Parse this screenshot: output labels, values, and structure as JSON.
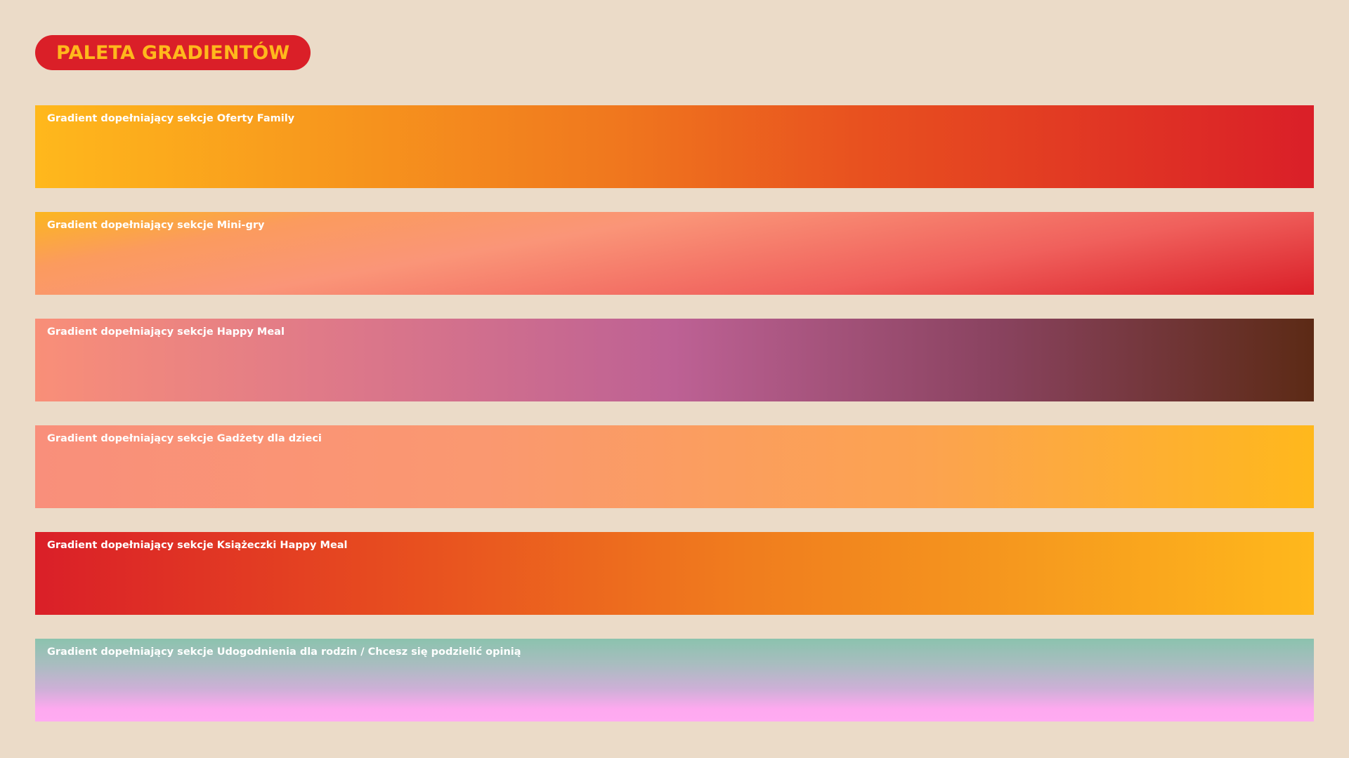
{
  "header": {
    "title": "PALETA GRADIENTÓW",
    "pill_color": "#da1f28",
    "title_color": "#ffb81c"
  },
  "background_color": "#ebdbc8",
  "gradients": [
    {
      "label": "Gradient dopełniający sekcje Oferty Family",
      "colors": [
        "#ffb81c",
        "#f0781e",
        "#e8501f",
        "#da1f28"
      ]
    },
    {
      "label": "Gradient dopełniający sekcje Mini-gry",
      "colors": [
        "#fbb61f",
        "#fa9578",
        "#f0605c",
        "#da1f28"
      ]
    },
    {
      "label": "Gradient dopełniający sekcje  Happy Meal",
      "colors": [
        "#f98f78",
        "#bd6194",
        "#8a4360",
        "#5c2a15"
      ]
    },
    {
      "label": "Gradient dopełniający sekcje  Gadżety dla dzieci",
      "colors": [
        "#f98f7b",
        "#fca34f",
        "#ffb81c"
      ]
    },
    {
      "label": "Gradient dopełniający sekcje Książeczki Happy Meal",
      "colors": [
        "#da1f28",
        "#e8501f",
        "#f07c1e",
        "#ffb81c"
      ]
    },
    {
      "label": "Gradient dopełniający sekcje Udogodnienia dla rodzin / Chcesz się podzielić opinią",
      "colors": [
        "#8bc3ae",
        "#ccb0d6",
        "#ffabf2"
      ]
    }
  ]
}
